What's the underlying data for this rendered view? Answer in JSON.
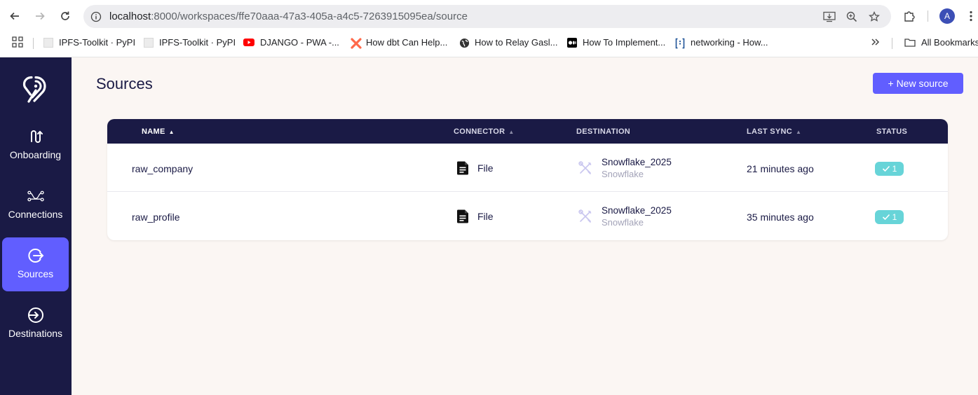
{
  "browser": {
    "url_host": "localhost",
    "url_rest": ":8000/workspaces/ffe70aaa-47a3-405a-a4c5-7263915095ea/source",
    "profile_initial": "A",
    "bookmarks": [
      {
        "label": "IPFS-Toolkit · PyPI",
        "icon": "pypi-icon"
      },
      {
        "label": "IPFS-Toolkit · PyPI",
        "icon": "pypi-icon"
      },
      {
        "label": "DJANGO - PWA -...",
        "icon": "youtube-icon"
      },
      {
        "label": "How dbt Can Help...",
        "icon": "dbt-icon"
      },
      {
        "label": "How to Relay Gasl...",
        "icon": "globe-icon"
      },
      {
        "label": "How To Implement...",
        "icon": "medium-icon"
      },
      {
        "label": "networking - How...",
        "icon": "stackexchange-icon"
      }
    ],
    "all_bookmarks_label": "All Bookmarks"
  },
  "sidebar": {
    "items": [
      {
        "label": "Onboarding",
        "icon": "onboarding-icon",
        "active": false
      },
      {
        "label": "Connections",
        "icon": "connections-icon",
        "active": false
      },
      {
        "label": "Sources",
        "icon": "sources-icon",
        "active": true
      },
      {
        "label": "Destinations",
        "icon": "destinations-icon",
        "active": false
      }
    ]
  },
  "page": {
    "title": "Sources",
    "new_button": "+ New source"
  },
  "table": {
    "headers": {
      "name": "NAME",
      "connector": "CONNECTOR",
      "destination": "DESTINATION",
      "last_sync": "LAST SYNC",
      "status": "STATUS"
    },
    "rows": [
      {
        "name": "raw_company",
        "connector": "File",
        "dest_name": "Snowflake_2025",
        "dest_type": "Snowflake",
        "last_sync": "21 minutes ago",
        "status": "1"
      },
      {
        "name": "raw_profile",
        "connector": "File",
        "dest_name": "Snowflake_2025",
        "dest_type": "Snowflake",
        "last_sync": "35 minutes ago",
        "status": "1"
      }
    ]
  },
  "colors": {
    "sidebar_bg": "#1a1a45",
    "accent": "#615eff",
    "status_badge": "#67d4d8",
    "page_bg": "#fbf6f3"
  }
}
